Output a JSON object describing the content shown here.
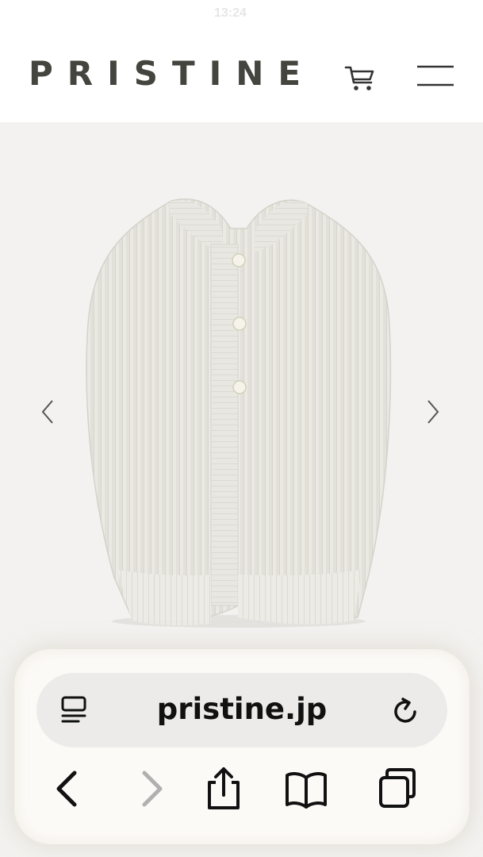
{
  "status_bar": {
    "time": "13:24"
  },
  "header": {
    "brand": "PRISTINE",
    "icons": {
      "cart": "cart-icon",
      "menu": "hamburger-menu-icon"
    }
  },
  "gallery": {
    "product": "knit-cardigan-vest-image",
    "prev_icon": "chevron-left-icon",
    "next_icon": "chevron-right-icon"
  },
  "browser": {
    "url": "pristine.jp",
    "icons": {
      "reader": "reader-mode-icon",
      "reload": "reload-icon",
      "back": "back-icon",
      "forward": "forward-icon",
      "share": "share-icon",
      "bookmarks": "bookmarks-icon",
      "tabs": "tabs-icon"
    }
  },
  "colors": {
    "brand_text": "#45453f",
    "page_background": "#f3f2f0",
    "header_background": "#ffffff",
    "url_bar_background": "#ecebe9",
    "forward_disabled": "#b0b0b0"
  }
}
